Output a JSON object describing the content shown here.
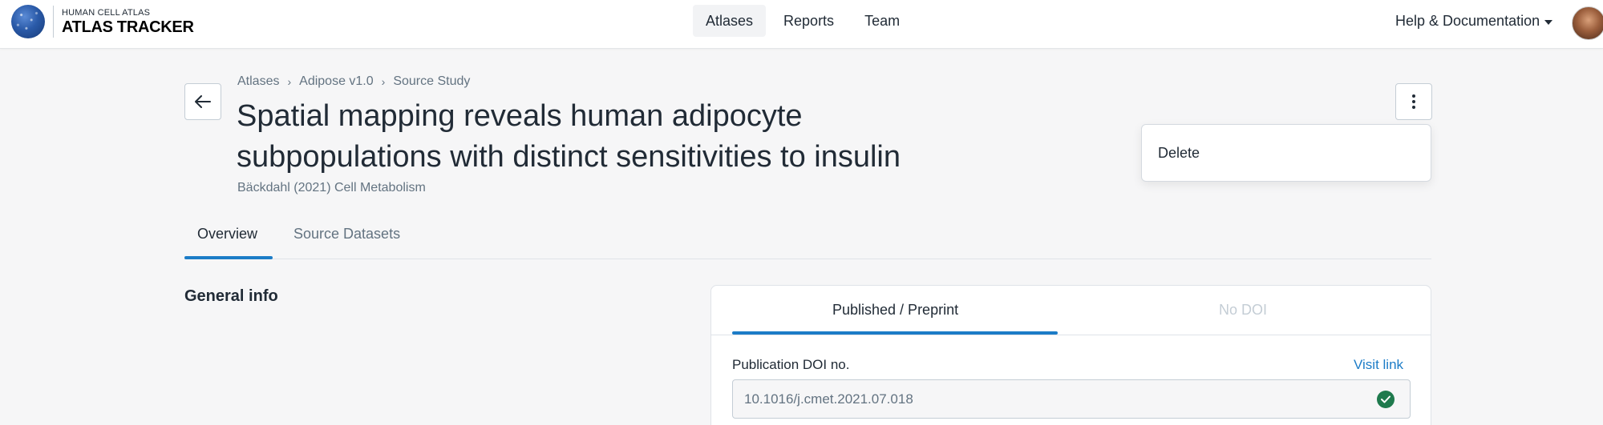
{
  "header": {
    "logo_small": "HUMAN CELL ATLAS",
    "logo_big": "ATLAS TRACKER",
    "nav": [
      {
        "label": "Atlases",
        "active": true
      },
      {
        "label": "Reports",
        "active": false
      },
      {
        "label": "Team",
        "active": false
      }
    ],
    "help_label": "Help & Documentation"
  },
  "breadcrumb": [
    "Atlases",
    "Adipose v1.0",
    "Source Study"
  ],
  "page": {
    "title": "Spatial mapping reveals human adipocyte subpopulations with distinct sensitivities to insulin",
    "subtitle": "Bäckdahl (2021) Cell Metabolism"
  },
  "menu": {
    "items": [
      "Delete"
    ]
  },
  "tabs": [
    {
      "label": "Overview",
      "active": true
    },
    {
      "label": "Source Datasets",
      "active": false
    }
  ],
  "section": {
    "title": "General info"
  },
  "card": {
    "tabs": [
      {
        "label": "Published / Preprint",
        "active": true
      },
      {
        "label": "No DOI",
        "active": false
      }
    ],
    "doi_label": "Publication DOI no.",
    "visit_link": "Visit link",
    "doi_value": "10.1016/j.cmet.2021.07.018"
  },
  "colors": {
    "accent": "#1c7cc7",
    "success": "#1f7a4d"
  }
}
